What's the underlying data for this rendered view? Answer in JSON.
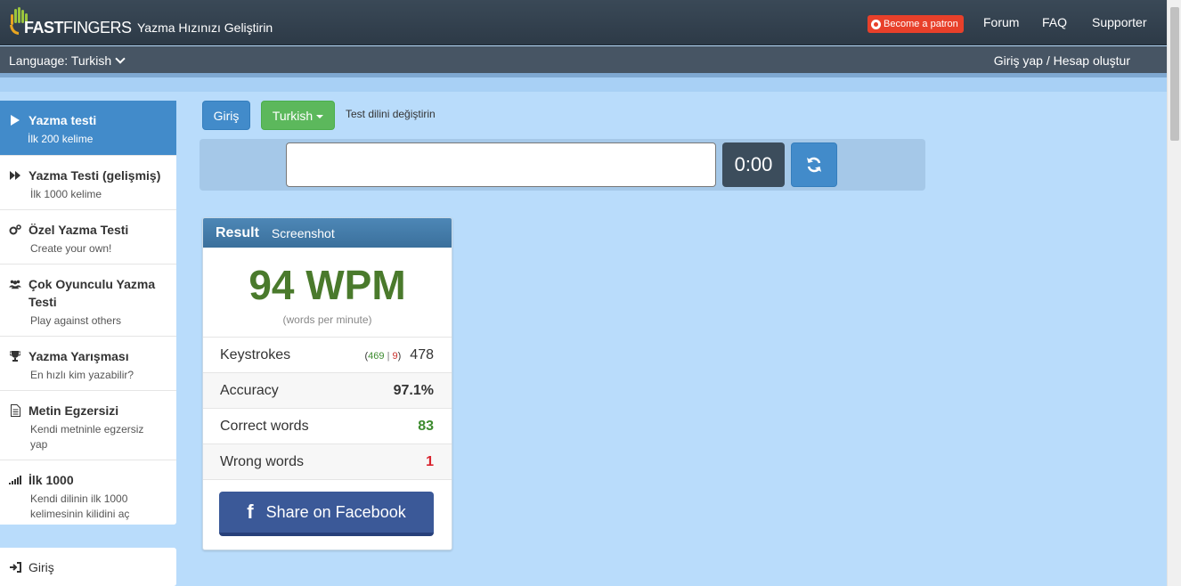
{
  "header": {
    "logo_text_bold": "FAST",
    "logo_text_rest": "FINGERS",
    "tagline": "Yazma Hızınızı Geliştirin",
    "patron_label": "Become a patron",
    "nav": [
      "Forum",
      "FAQ",
      "Supporter"
    ]
  },
  "subbar": {
    "language_label": "Language: Turkish",
    "login_label": "Giriş yap / Hesap oluştur"
  },
  "sidebar": {
    "items": [
      {
        "title": "Yazma testi",
        "sub": "İlk 200 kelime",
        "icon": "play-icon",
        "active": true
      },
      {
        "title": "Yazma Testi (gelişmiş)",
        "sub": "İlk 1000 kelime",
        "icon": "fast-forward-icon"
      },
      {
        "title": "Özel Yazma Testi",
        "sub": "Create your own!",
        "icon": "gears-icon"
      },
      {
        "title": "Çok Oyunculu Yazma Testi",
        "sub": "Play against others",
        "icon": "users-icon"
      },
      {
        "title": "Yazma Yarışması",
        "sub": "En hızlı kim yazabilir?",
        "icon": "trophy-icon"
      },
      {
        "title": "Metin Egzersizi",
        "sub": "Kendi metninle egzersiz yap",
        "icon": "document-icon"
      },
      {
        "title": "İlk 1000",
        "sub": "Kendi dilinin ilk 1000 kelimesinin kilidini aç",
        "icon": "signal-icon"
      }
    ],
    "login_item": "Giriş"
  },
  "controls": {
    "login_button": "Giriş",
    "language_button": "Turkish",
    "change_language_text": "Test dilini değiştirin",
    "input_value": "",
    "timer": "0:00"
  },
  "result": {
    "title": "Result",
    "screenshot_label": "Screenshot",
    "wpm": "94 WPM",
    "wpm_sub": "(words per minute)",
    "keystrokes_label": "Keystrokes",
    "keystrokes_correct": "469",
    "keystrokes_wrong": "9",
    "keystrokes_total": "478",
    "accuracy_label": "Accuracy",
    "accuracy_value": "97.1%",
    "correct_words_label": "Correct words",
    "correct_words_value": "83",
    "wrong_words_label": "Wrong words",
    "wrong_words_value": "1",
    "facebook_label": "Share on Facebook"
  },
  "colors": {
    "header_bg": "#2d3a47",
    "primary_blue": "#428bca",
    "green_button": "#5cb85c",
    "wpm_green": "#4a7a2c",
    "facebook_blue": "#3b5998",
    "page_bg": "#b9dcfb"
  }
}
